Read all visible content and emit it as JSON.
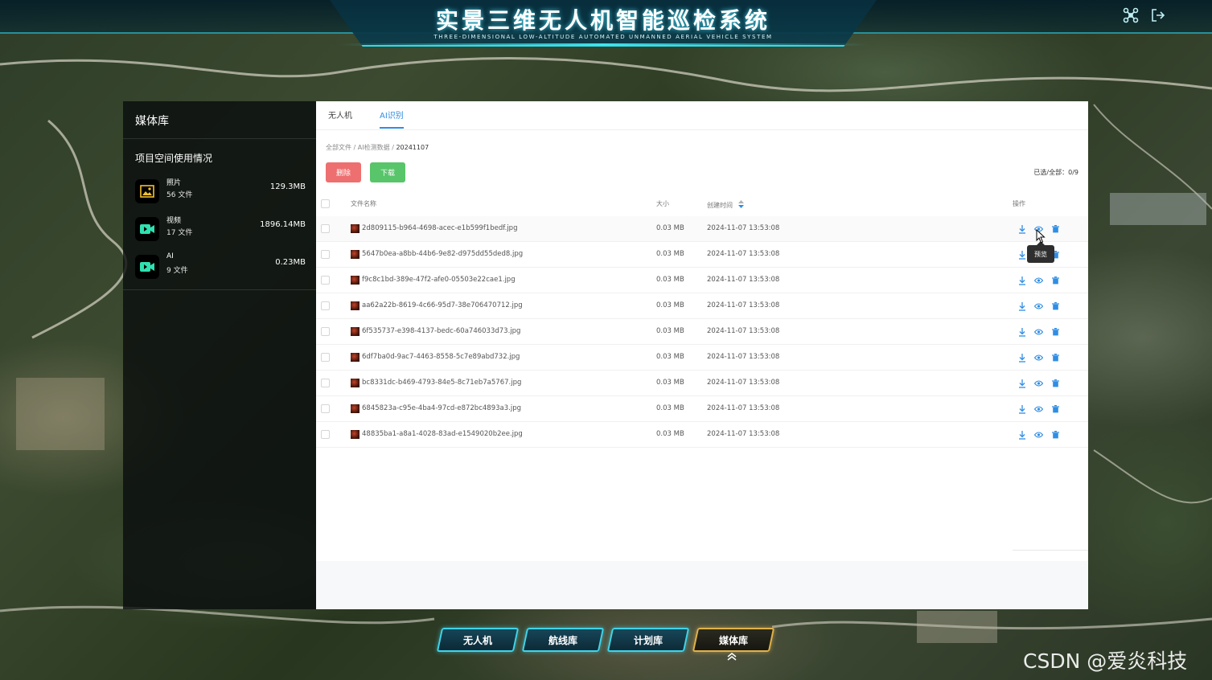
{
  "header": {
    "title": "实景三维无人机智能巡检系统",
    "subtitle": "THREE-DIMENSIONAL LOW-ALTITUDE AUTOMATED UNMANNED AERIAL VEHICLE SYSTEM",
    "icons": [
      "drone-icon",
      "logout-icon"
    ]
  },
  "sidebar": {
    "title": "媒体库",
    "usage_title": "项目空间使用情况",
    "items": [
      {
        "name": "照片",
        "count": "56 文件",
        "size": "129.3MB",
        "icon": "image-icon"
      },
      {
        "name": "视频",
        "count": "17 文件",
        "size": "1896.14MB",
        "icon": "video-icon"
      },
      {
        "name": "AI",
        "count": "9 文件",
        "size": "0.23MB",
        "icon": "ai-video-icon"
      }
    ]
  },
  "main": {
    "tabs": [
      {
        "label": "无人机",
        "active": false
      },
      {
        "label": "AI识别",
        "active": true
      }
    ],
    "breadcrumb": {
      "root": "全部文件",
      "mid": "AI检测数据",
      "current": "20241107",
      "sep": "/"
    },
    "buttons": {
      "delete": "删除",
      "download": "下载"
    },
    "selected_label": "已选/全部：",
    "selected_value": "0/9",
    "columns": {
      "name": "文件名称",
      "size": "大小",
      "time": "创建时间",
      "ops": "操作"
    },
    "rows": [
      {
        "name": "2d809115-b964-4698-acec-e1b599f1bedf.jpg",
        "size": "0.03 MB",
        "time": "2024-11-07 13:53:08"
      },
      {
        "name": "5647b0ea-a8bb-44b6-9e82-d975dd55ded8.jpg",
        "size": "0.03 MB",
        "time": "2024-11-07 13:53:08"
      },
      {
        "name": "f9c8c1bd-389e-47f2-afe0-05503e22cae1.jpg",
        "size": "0.03 MB",
        "time": "2024-11-07 13:53:08"
      },
      {
        "name": "aa62a22b-8619-4c66-95d7-38e706470712.jpg",
        "size": "0.03 MB",
        "time": "2024-11-07 13:53:08"
      },
      {
        "name": "6f535737-e398-4137-bedc-60a746033d73.jpg",
        "size": "0.03 MB",
        "time": "2024-11-07 13:53:08"
      },
      {
        "name": "6df7ba0d-9ac7-4463-8558-5c7e89abd732.jpg",
        "size": "0.03 MB",
        "time": "2024-11-07 13:53:08"
      },
      {
        "name": "bc8331dc-b469-4793-84e5-8c71eb7a5767.jpg",
        "size": "0.03 MB",
        "time": "2024-11-07 13:53:08"
      },
      {
        "name": "6845823a-c95e-4ba4-97cd-e872bc4893a3.jpg",
        "size": "0.03 MB",
        "time": "2024-11-07 13:53:08"
      },
      {
        "name": "48835ba1-a8a1-4028-83ad-e1549020b2ee.jpg",
        "size": "0.03 MB",
        "time": "2024-11-07 13:53:08"
      }
    ],
    "tooltip": "预览"
  },
  "nav": {
    "items": [
      {
        "label": "无人机",
        "active": false
      },
      {
        "label": "航线库",
        "active": false
      },
      {
        "label": "计划库",
        "active": false
      },
      {
        "label": "媒体库",
        "active": true
      }
    ]
  },
  "watermark": "CSDN @爱炎科技",
  "colors": {
    "accent": "#2f8de4",
    "delete": "#ee6f6f",
    "download": "#58c56a",
    "nav_border": "#3fd4e8",
    "nav_active": "#e0b24a"
  }
}
